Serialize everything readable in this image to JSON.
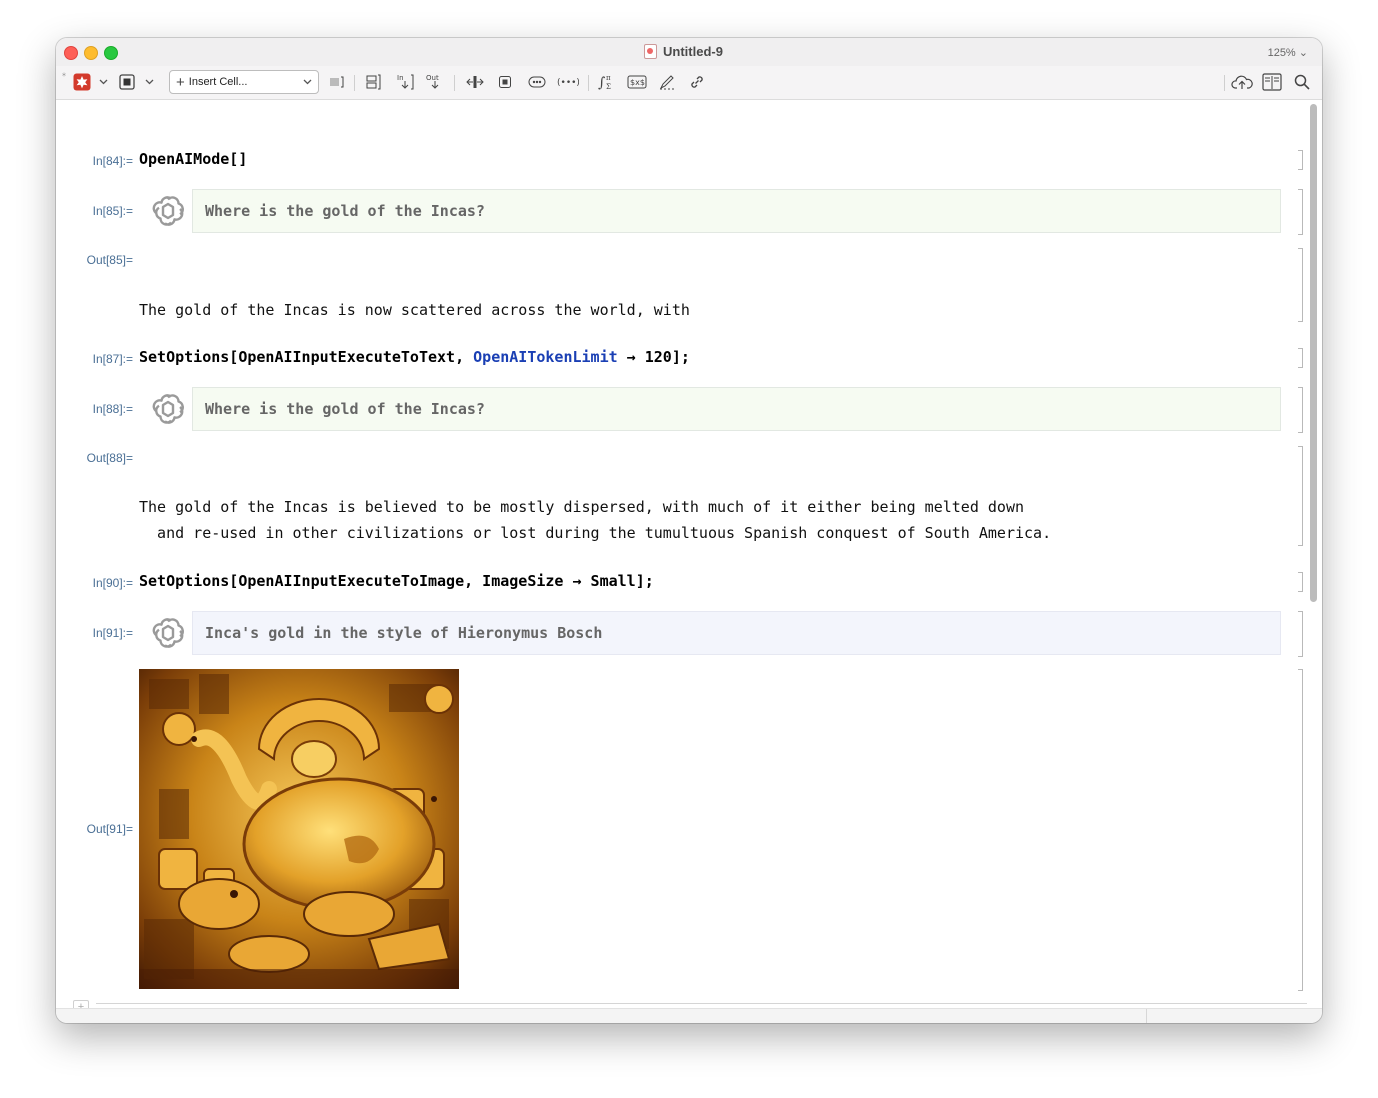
{
  "window": {
    "title": "Untitled-9",
    "zoom": "125% ⌄"
  },
  "toolbar": {
    "insert_cell_label": "Insert Cell...",
    "icons": [
      "evaluate-icon",
      "stop-icon",
      "cell-bracket-icon",
      "input-above-icon",
      "output-below-icon",
      "split-cell-icon",
      "cell-group-icon",
      "ellipsis-icon",
      "template-icon",
      "formula-icon",
      "inline-math-icon",
      "drawing-icon",
      "link-icon",
      "cloud-upload-icon",
      "notebook-icon",
      "search-icon"
    ]
  },
  "cells": [
    {
      "label": "In[84]:=",
      "code": "OpenAIMode[]"
    },
    {
      "label": "In[85]:=",
      "prompt": "Where is the gold of the Incas?"
    },
    {
      "label": "Out[85]=",
      "text": "The gold of the Incas is now scattered across the world, with"
    },
    {
      "label": "In[87]:=",
      "code_a": "SetOptions[OpenAIInputExecuteToText, ",
      "code_sym": "OpenAITokenLimit",
      "code_b": " → 120];"
    },
    {
      "label": "In[88]:=",
      "prompt": "Where is the gold of the Incas?"
    },
    {
      "label": "Out[88]=",
      "text_1": "The gold of the Incas is believed to be mostly dispersed, with much of it either being melted down",
      "text_2": "  and re-used in other civilizations or lost during the tumultuous Spanish conquest of South America."
    },
    {
      "label": "In[90]:=",
      "code": "SetOptions[OpenAIInputExecuteToImage, ImageSize → Small];"
    },
    {
      "label": "In[91]:=",
      "prompt": "Inca's gold in the style of Hieronymus Bosch"
    },
    {
      "label": "Out[91]="
    }
  ],
  "colors": {
    "label": "#4a6f95",
    "symbol": "#1a3fb4",
    "prompt_bg_green": "#f6fbf2",
    "prompt_bg_blue": "#f3f5fc",
    "gold": "#d89a22"
  }
}
